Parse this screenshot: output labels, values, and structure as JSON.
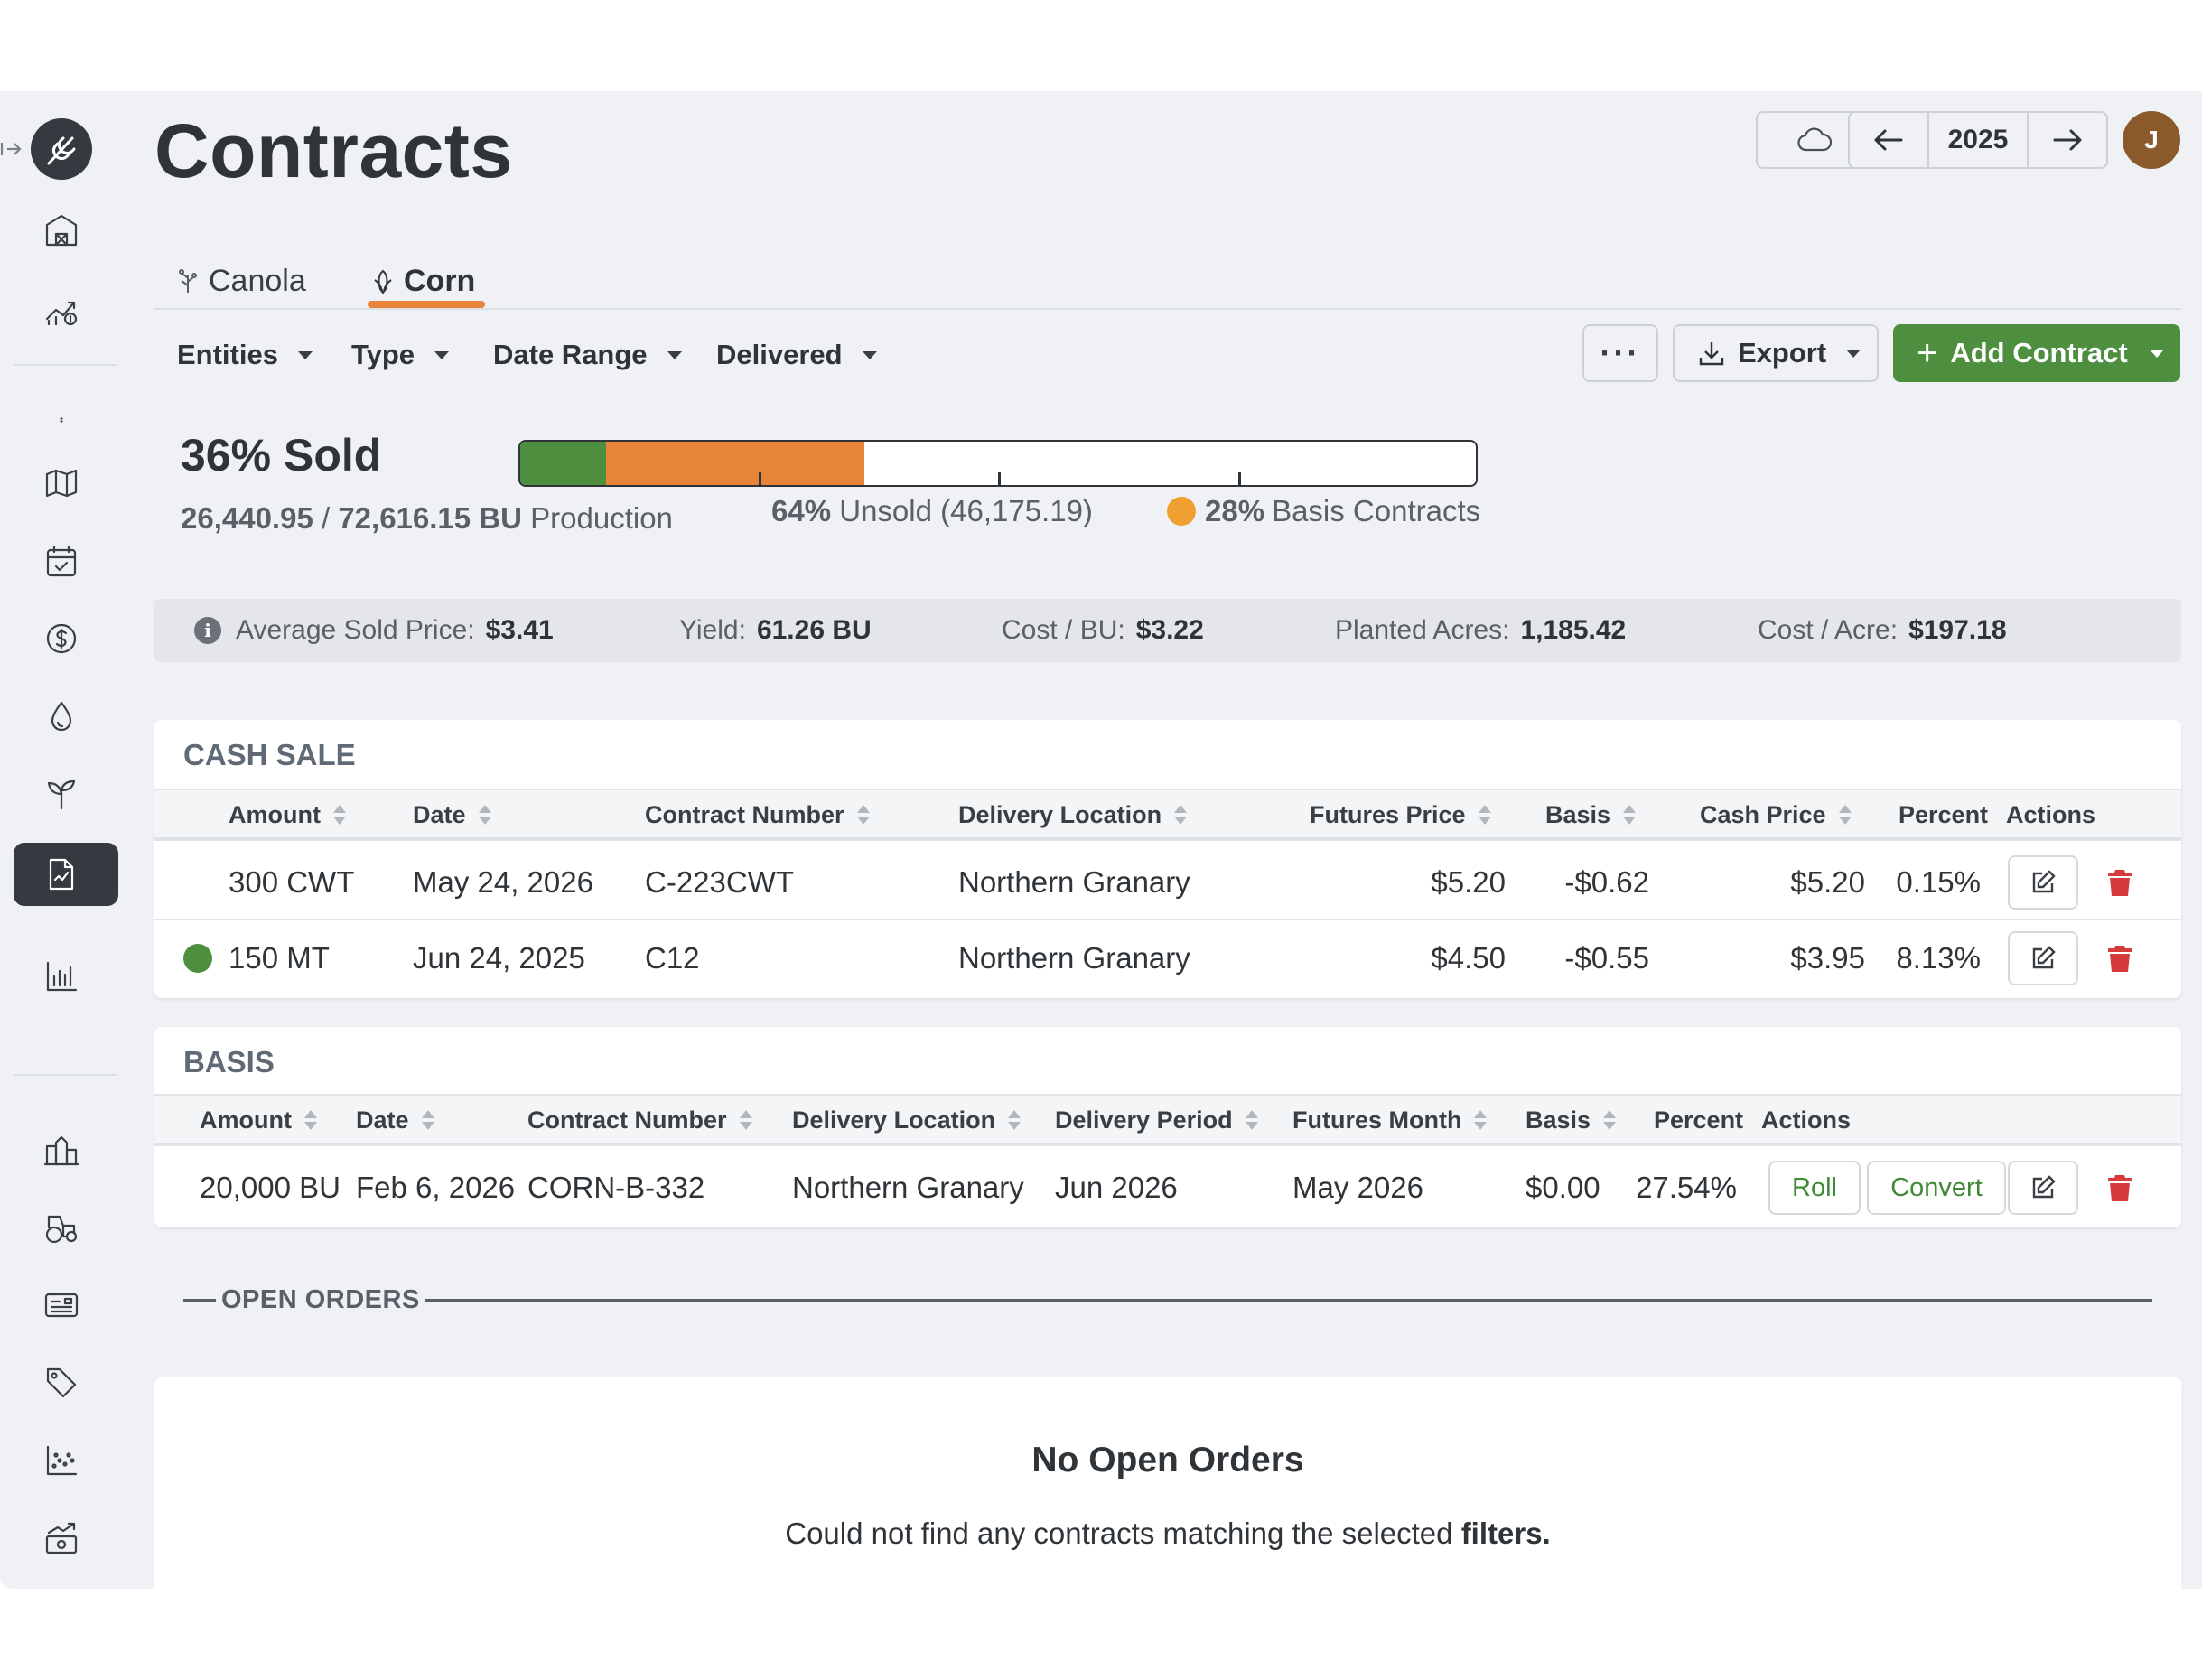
{
  "page": {
    "title": "Contracts"
  },
  "header": {
    "year": "2025",
    "avatar_initial": "J"
  },
  "tabs": [
    {
      "label": "Canola",
      "icon": "canola-icon"
    },
    {
      "label": "Corn",
      "icon": "corn-icon",
      "active": true
    }
  ],
  "filters": [
    "Entities",
    "Type",
    "Date Range",
    "Delivered"
  ],
  "toolbar": {
    "more_label": "···",
    "export_label": "Export",
    "add_label": "Add Contract"
  },
  "summary": {
    "sold_title": "36% Sold",
    "sold_amount": "26,440.95",
    "production_amount": "72,616.15 BU",
    "production_label": "Production",
    "unsold_pct": "64%",
    "unsold_text": "Unsold (46,175.19)",
    "basis_pct": "28%",
    "basis_text": "Basis Contracts",
    "progress": {
      "sold_fraction": 0.09,
      "basis_fraction": 0.27
    }
  },
  "stats": [
    {
      "label": "Average Sold Price:",
      "value": "$3.41"
    },
    {
      "label": "Yield:",
      "value": "61.26 BU"
    },
    {
      "label": "Cost / BU:",
      "value": "$3.22"
    },
    {
      "label": "Planted Acres:",
      "value": "1,185.42"
    },
    {
      "label": "Cost / Acre:",
      "value": "$197.18"
    }
  ],
  "cash_sale": {
    "title": "CASH SALE",
    "columns": [
      "Amount",
      "Date",
      "Contract Number",
      "Delivery Location",
      "Futures Price",
      "Basis",
      "Cash Price",
      "Percent",
      "Actions"
    ],
    "rows": [
      {
        "amount": "300 CWT",
        "date": "May 24, 2026",
        "contract": "C-223CWT",
        "location": "Northern Granary",
        "futures": "$5.20",
        "basis": "-$0.62",
        "cash": "$5.20",
        "percent": "0.15%",
        "delivered": false
      },
      {
        "amount": "150 MT",
        "date": "Jun 24, 2025",
        "contract": "C12",
        "location": "Northern Granary",
        "futures": "$4.50",
        "basis": "-$0.55",
        "cash": "$3.95",
        "percent": "8.13%",
        "delivered": true
      }
    ]
  },
  "basis_table": {
    "title": "BASIS",
    "columns": [
      "Amount",
      "Date",
      "Contract Number",
      "Delivery Location",
      "Delivery Period",
      "Futures Month",
      "Basis",
      "Percent",
      "Actions"
    ],
    "rows": [
      {
        "amount": "20,000 BU",
        "date": "Feb 6, 2026",
        "contract": "CORN-B-332",
        "location": "Northern Granary",
        "period": "Jun 2026",
        "futures_month": "May 2026",
        "basis": "$0.00",
        "percent": "27.54%",
        "roll_label": "Roll",
        "convert_label": "Convert"
      }
    ]
  },
  "open_orders": {
    "title": "OPEN ORDERS",
    "empty_title": "No Open Orders",
    "empty_text": "Could not find any contracts matching the selected",
    "empty_text_bold": "filters."
  },
  "colors": {
    "sold": "#4e8e3f",
    "basis": "#e8833a",
    "basis_dot": "#f0a030",
    "primary_button": "#4e8e3f",
    "delete": "#d63a3a"
  }
}
